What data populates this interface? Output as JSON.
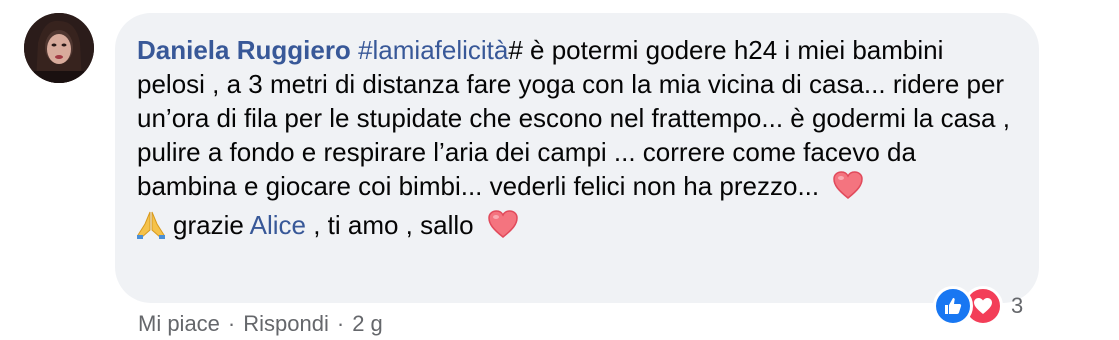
{
  "comment": {
    "author": "Daniela Ruggiero",
    "hashtag": "#lamiafelicità",
    "text_part1": "# è potermi godere h24 i miei bambini pelosi , a 3 metri di distanza fare yoga con la mia vicina di casa... ridere per un’ora di fila per le stupidate che escono nel frattempo... è godermi la casa , pulire a fondo e respirare l’aria dei campi ... correre come facevo da bambina e giocare coi bimbi... vederli felici non ha prezzo...",
    "line2_prefix": "grazie ",
    "mention": "Alice",
    "line2_suffix": " , ti amo , sallo"
  },
  "reactions": {
    "types": [
      "like-icon",
      "love-icon"
    ],
    "count": "3"
  },
  "actions": {
    "like": "Mi piace",
    "reply": "Rispondi",
    "separator": "·",
    "time": "2 g"
  },
  "colors": {
    "link": "#385898",
    "bubble": "#f0f2f5",
    "meta": "#65676b",
    "like": "#1877f2",
    "love": "#f33e58"
  }
}
